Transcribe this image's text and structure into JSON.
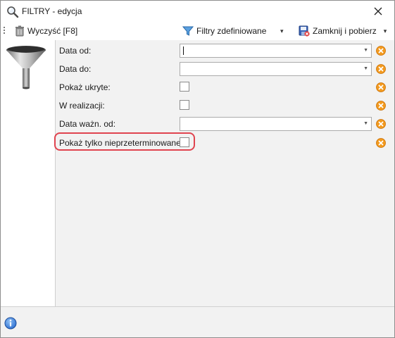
{
  "window": {
    "title": "FILTRY - edycja"
  },
  "toolbar": {
    "clear_label": "Wyczyść [F8]",
    "filters_label": "Filtry zdefiniowane",
    "filters_dropdown": "▾",
    "close_label": "Zamknij i pobierz",
    "close_dropdown": "▾"
  },
  "fields": [
    {
      "label": "Data od:",
      "type": "combo",
      "value": ""
    },
    {
      "label": "Data do:",
      "type": "combo",
      "value": ""
    },
    {
      "label": "Pokaż ukryte:",
      "type": "checkbox",
      "checked": false
    },
    {
      "label": "W realizacji:",
      "type": "checkbox",
      "checked": false
    },
    {
      "label": "Data ważn. od:",
      "type": "combo",
      "value": ""
    },
    {
      "label": "Pokaż tylko nieprzeterminowane:",
      "type": "checkbox",
      "checked": false
    }
  ],
  "icons": {
    "title": "search-filter-icon",
    "clear": "trash-can-icon",
    "filters": "funnel-icon",
    "close": "save-close-icon",
    "field_clear": "clear-x-icon",
    "info": "info-icon"
  },
  "colors": {
    "accent_orange": "#f39a1e",
    "highlight_red": "#e0444f",
    "info_blue": "#2d6fd1"
  }
}
